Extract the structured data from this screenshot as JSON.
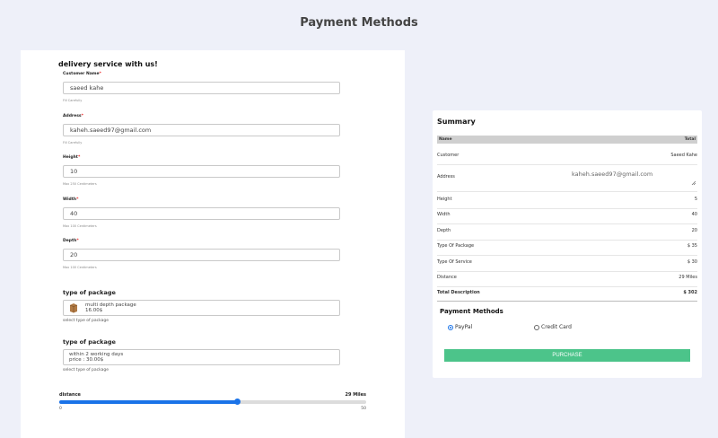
{
  "page": {
    "title": "Payment Methods"
  },
  "form": {
    "heading": "delivery service with us!",
    "required_mark": "*",
    "fields": {
      "customer_name": {
        "label": "Customer Name",
        "value": "saeed kahe",
        "hint": "Fill Carefully"
      },
      "address": {
        "label": "Address",
        "value": "kaheh.saeed97@gmail.com",
        "hint": "Fill Carefully"
      },
      "height": {
        "label": "Height",
        "value": "10",
        "hint": "Max 250 Centimeters"
      },
      "width": {
        "label": "Width",
        "value": "40",
        "hint": "Max 100 Centimeters"
      },
      "depth": {
        "label": "Depth",
        "value": "20",
        "hint": "Max 100 Centimeters"
      }
    },
    "package": {
      "label": "type of package",
      "line1": "multi depth package",
      "line2": "16.00$",
      "hint": "select type of package"
    },
    "service": {
      "label": "type of package",
      "line1": "within 2 working days",
      "line2": "price : 30.00$",
      "hint": "select type of package"
    },
    "distance": {
      "label": "distance",
      "value_text": "29 Miles",
      "value": 29,
      "min": 0,
      "max": 50,
      "min_label": "0",
      "max_label": "50"
    }
  },
  "summary": {
    "title": "Summary",
    "header_name": "Name",
    "header_total": "Total",
    "customer": {
      "label": "Customer",
      "value": "Saeed Kahe"
    },
    "address": {
      "label": "Address",
      "value": "kaheh.saeed97@gmail.com"
    },
    "height": {
      "label": "Height",
      "value": "5"
    },
    "width": {
      "label": "Width",
      "value": "40"
    },
    "depth": {
      "label": "Depth",
      "value": "20"
    },
    "package_type": {
      "label": "Type Of Package",
      "value": "$ 35"
    },
    "service_type": {
      "label": "Type Of Service",
      "value": "$ 30"
    },
    "distance": {
      "label": "Distance",
      "value": "29 Miles"
    },
    "total": {
      "label": "Total Description",
      "value": "$ 302"
    }
  },
  "payment": {
    "title": "Payment Methods",
    "options": [
      {
        "label": "PayPal",
        "selected": true
      },
      {
        "label": "Credit Card",
        "selected": false
      }
    ],
    "purchase_label": "PURCHASE"
  },
  "colors": {
    "accent": "#1a73e8",
    "purchase": "#4cc48a",
    "background": "#eef0f9"
  },
  "icons": {
    "package": "box-icon",
    "textarea_resize": "resize-grip-icon"
  }
}
